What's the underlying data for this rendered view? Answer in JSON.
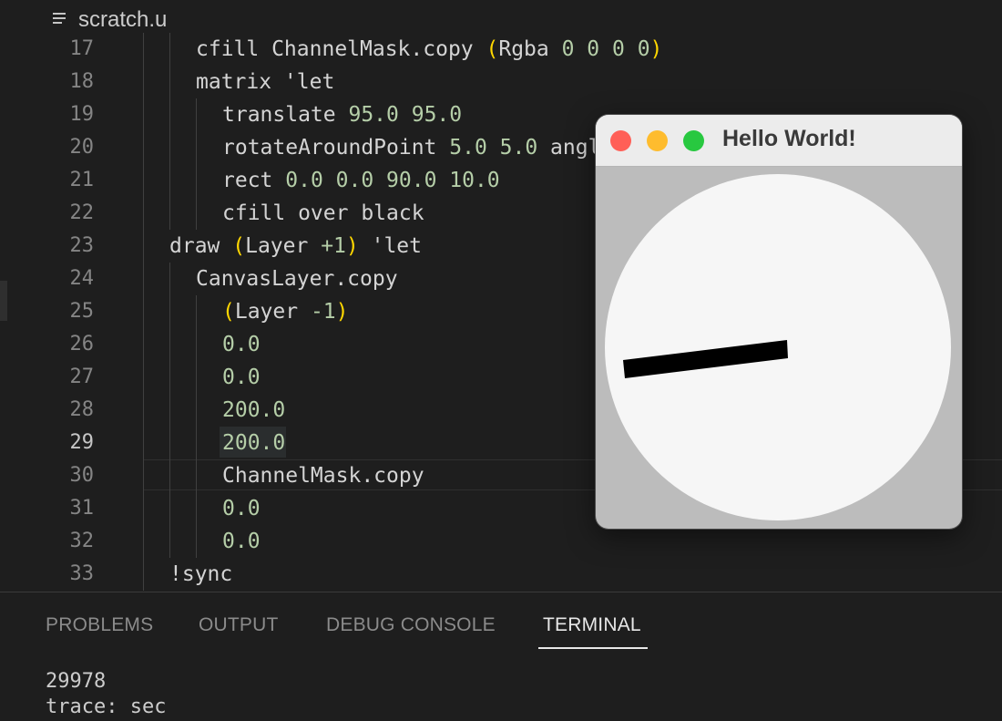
{
  "tab": {
    "title": "scratch.u"
  },
  "lines": [
    {
      "n": "17",
      "segs": [
        [
          "t",
          "cfill ChannelMask.copy "
        ],
        [
          "b",
          "("
        ],
        [
          "t",
          "Rgba "
        ],
        [
          "n",
          "0 0 0 0"
        ],
        [
          "b",
          ")"
        ]
      ]
    },
    {
      "n": "18",
      "segs": [
        [
          "t",
          "matrix 'let"
        ]
      ]
    },
    {
      "n": "19",
      "segs": [
        [
          "t",
          "translate "
        ],
        [
          "n",
          "95.0 95.0"
        ]
      ]
    },
    {
      "n": "20",
      "segs": [
        [
          "t",
          "rotateAroundPoint "
        ],
        [
          "n",
          "5.0 5.0"
        ],
        [
          "t",
          " angle"
        ]
      ]
    },
    {
      "n": "21",
      "segs": [
        [
          "t",
          "rect "
        ],
        [
          "n",
          "0.0 0.0 90.0 10.0"
        ]
      ]
    },
    {
      "n": "22",
      "segs": [
        [
          "t",
          "cfill over black"
        ]
      ]
    },
    {
      "n": "23",
      "segs": [
        [
          "t",
          "draw "
        ],
        [
          "b",
          "("
        ],
        [
          "t",
          "Layer "
        ],
        [
          "n",
          "+1"
        ],
        [
          "b",
          ")"
        ],
        [
          "t",
          " 'let"
        ]
      ]
    },
    {
      "n": "24",
      "segs": [
        [
          "t",
          "CanvasLayer.copy"
        ]
      ]
    },
    {
      "n": "25",
      "segs": [
        [
          "b",
          "("
        ],
        [
          "t",
          "Layer "
        ],
        [
          "n",
          "-1"
        ],
        [
          "b",
          ")"
        ]
      ]
    },
    {
      "n": "26",
      "segs": [
        [
          "n",
          "0.0"
        ]
      ]
    },
    {
      "n": "27",
      "segs": [
        [
          "n",
          "0.0"
        ]
      ]
    },
    {
      "n": "28",
      "segs": [
        [
          "n",
          "200.0"
        ]
      ]
    },
    {
      "n": "29",
      "segs": [
        [
          "n",
          "200.0"
        ]
      ]
    },
    {
      "n": "30",
      "segs": [
        [
          "t",
          "ChannelMask.copy"
        ]
      ]
    },
    {
      "n": "31",
      "segs": [
        [
          "n",
          "0.0"
        ]
      ]
    },
    {
      "n": "32",
      "segs": [
        [
          "n",
          "0.0"
        ]
      ]
    },
    {
      "n": "33",
      "segs": [
        [
          "t",
          "!sync"
        ]
      ]
    }
  ],
  "current_line": "29",
  "panel": {
    "tabs": [
      "PROBLEMS",
      "OUTPUT",
      "DEBUG CONSOLE",
      "TERMINAL"
    ],
    "active_tab": "TERMINAL",
    "terminal_lines": [
      "29978",
      "trace: sec"
    ]
  },
  "window": {
    "title": "Hello World!",
    "close_color": "#ff5f57",
    "minimize_color": "#febc2e",
    "zoom_color": "#28c840"
  },
  "colors": {
    "editor_bg": "#1e1e1e",
    "number": "#b5cea8",
    "bracket": "#ffd700"
  }
}
